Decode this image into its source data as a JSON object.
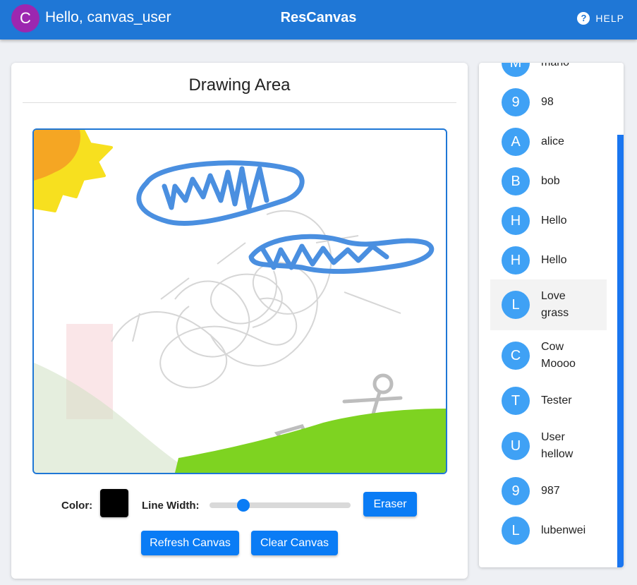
{
  "header": {
    "avatar_letter": "C",
    "greeting": "Hello, canvas_user",
    "app_title": "ResCanvas",
    "help_icon": "?",
    "help_label": "HELP"
  },
  "drawing": {
    "title": "Drawing Area",
    "color_label": "Color:",
    "current_color": "#000000",
    "line_width_label": "Line Width:",
    "line_width_fraction": 0.24,
    "eraser_label": "Eraser",
    "refresh_label": "Refresh Canvas",
    "clear_label": "Clear Canvas"
  },
  "rooms": [
    {
      "letter": "M",
      "name": "mano"
    },
    {
      "letter": "9",
      "name": "98"
    },
    {
      "letter": "A",
      "name": "alice"
    },
    {
      "letter": "B",
      "name": "bob"
    },
    {
      "letter": "H",
      "name": "Hello"
    },
    {
      "letter": "H",
      "name": "Hello"
    },
    {
      "letter": "L",
      "name": "Love\ngrass"
    },
    {
      "letter": "C",
      "name": "Cow\nMoooo"
    },
    {
      "letter": "T",
      "name": "Tester"
    },
    {
      "letter": "U",
      "name": "User\nhellow"
    },
    {
      "letter": "9",
      "name": "987"
    },
    {
      "letter": "L",
      "name": "lubenwei"
    }
  ],
  "colors": {
    "appbar": "#1f77d6",
    "accent": "#0a7cf5",
    "room_avatar": "#3fa1f5",
    "user_avatar": "#9c27b0",
    "stroke_blue": "#4a8fe0",
    "grass_green": "#7ed321",
    "sun_yellow": "#f7e01f",
    "sun_orange": "#f5a623"
  }
}
